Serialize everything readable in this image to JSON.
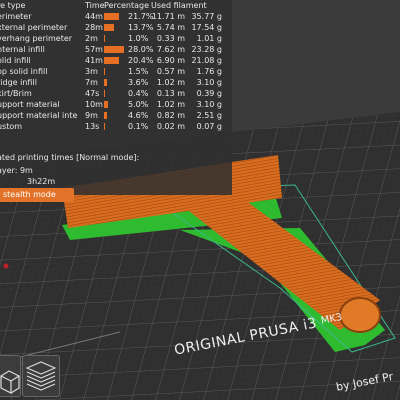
{
  "stats": {
    "header": {
      "type": "re type",
      "time": "Time",
      "percentage": "Percentage",
      "used_filament": "Used filament"
    },
    "rows": [
      {
        "name": "erimeter",
        "time": "44m",
        "percent": "21.7%",
        "length": "11.71 m",
        "weight": "35.77 g",
        "fraction": 0.217
      },
      {
        "name": "xternal perimeter",
        "time": "28m",
        "percent": "13.7%",
        "length": "5.74 m",
        "weight": "17.54 g",
        "fraction": 0.137
      },
      {
        "name": "verhang perimeter",
        "time": "2m",
        "percent": "1.0%",
        "length": "0.33 m",
        "weight": "1.01 g",
        "fraction": 0.01
      },
      {
        "name": "nternal infill",
        "time": "57m",
        "percent": "28.0%",
        "length": "7.62 m",
        "weight": "23.28 g",
        "fraction": 0.28
      },
      {
        "name": "olid infill",
        "time": "41m",
        "percent": "20.4%",
        "length": "6.90 m",
        "weight": "21.08 g",
        "fraction": 0.204
      },
      {
        "name": "op solid infill",
        "time": "3m",
        "percent": "1.5%",
        "length": "0.57 m",
        "weight": "1.76 g",
        "fraction": 0.015
      },
      {
        "name": "ridge infill",
        "time": "7m",
        "percent": "3.6%",
        "length": "1.02 m",
        "weight": "3.10 g",
        "fraction": 0.036
      },
      {
        "name": "kirt/Brim",
        "time": "47s",
        "percent": "0.4%",
        "length": "0.13 m",
        "weight": "0.39 g",
        "fraction": 0.004
      },
      {
        "name": "upport material",
        "time": "10m",
        "percent": "5.0%",
        "length": "1.02 m",
        "weight": "3.10 g",
        "fraction": 0.05
      },
      {
        "name": "upport material interface",
        "time": "9m",
        "percent": "4.6%",
        "length": "0.82 m",
        "weight": "2.51 g",
        "fraction": 0.046
      },
      {
        "name": "ustom",
        "time": "13s",
        "percent": "0.1%",
        "length": "0.02 m",
        "weight": "0.07 g",
        "fraction": 0.001
      }
    ],
    "times_title": "ated printing times [Normal mode]:",
    "layer_label": "ayer: 9m",
    "total_time": "3h22m",
    "stealth_button": "stealth mode"
  },
  "bed": {
    "label": "ORIGINAL PRUSA i3",
    "model": "MK3",
    "author": "by Josef Pr"
  },
  "colors": {
    "bar": "#e46f25",
    "extrusion": "#d86c1f",
    "support": "#2fbb2f",
    "panel": "#303030",
    "bed": "#2f2f2f"
  },
  "icons": {
    "view_3d": "cube-icon",
    "view_layers": "layers-icon"
  }
}
